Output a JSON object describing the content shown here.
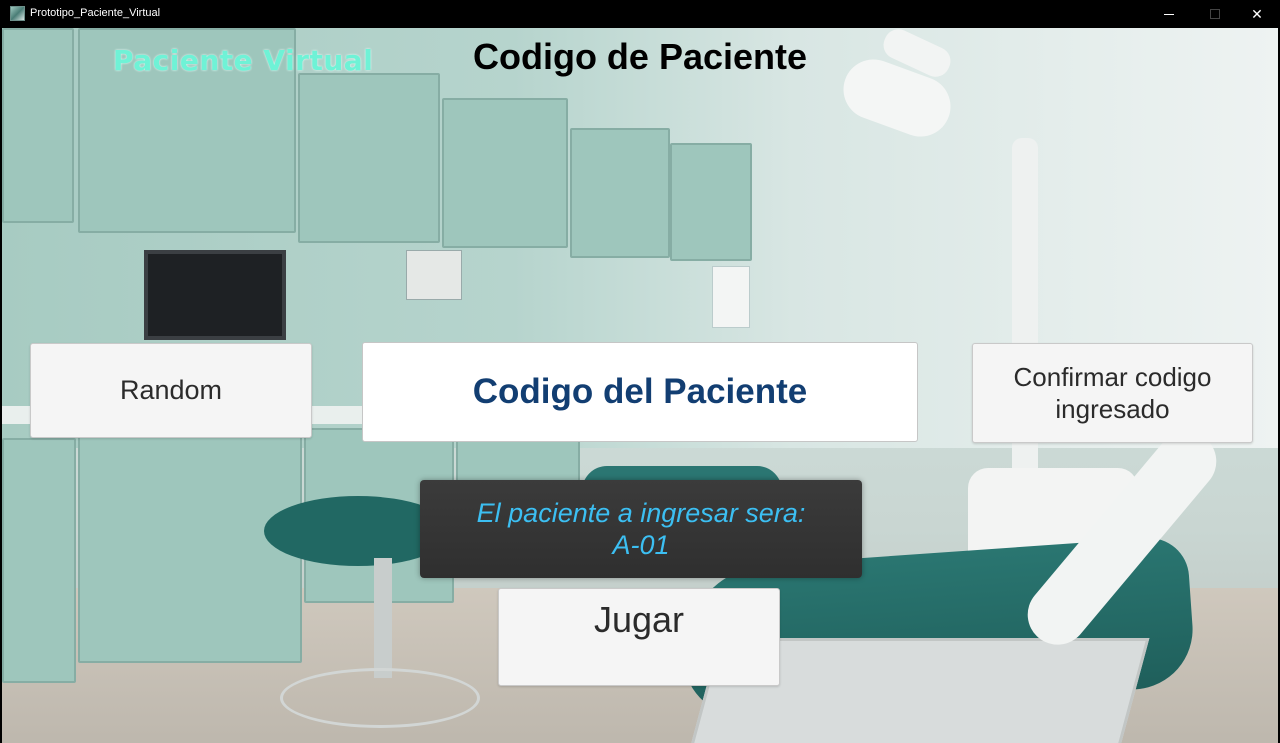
{
  "window": {
    "title": "Prototipo_Paciente_Virtual",
    "controls": {
      "minimize": "—",
      "maximize": "☐",
      "close": "✕"
    }
  },
  "header": {
    "brand": "Paciente Virtual",
    "title": "Codigo de Paciente"
  },
  "actions": {
    "random_label": "Random",
    "code_field_text": "Codigo del Paciente",
    "confirm_label": "Confirmar codigo ingresado",
    "play_label": "Jugar"
  },
  "info": {
    "line1": "El paciente a ingresar sera:",
    "line2": "A-01"
  },
  "colors": {
    "brand": "#6ff2d6",
    "code_text": "#123e72",
    "info_text": "#3cbff2",
    "info_bg": "#333333"
  }
}
